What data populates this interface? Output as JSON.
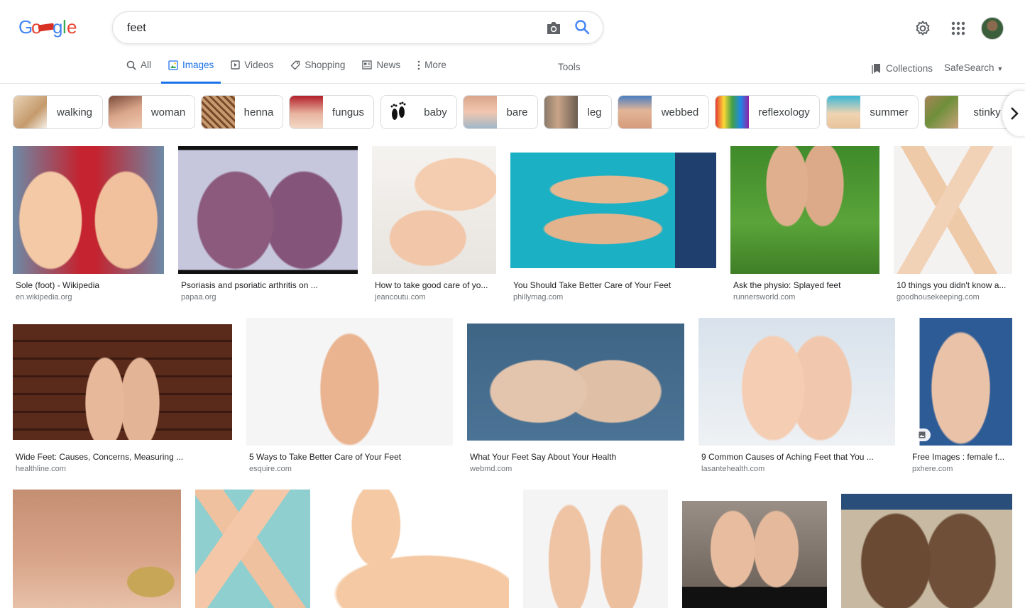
{
  "search": {
    "query": "feet"
  },
  "tabs": [
    {
      "label": "All",
      "icon": "search-icon"
    },
    {
      "label": "Images",
      "icon": "image-icon",
      "active": true
    },
    {
      "label": "Videos",
      "icon": "video-icon"
    },
    {
      "label": "Shopping",
      "icon": "tag-icon"
    },
    {
      "label": "News",
      "icon": "news-icon"
    },
    {
      "label": "More",
      "icon": "more-vert-icon"
    }
  ],
  "tools_label": "Tools",
  "collections_label": "Collections",
  "safesearch_label": "SafeSearch",
  "chips": [
    "walking",
    "woman",
    "henna",
    "fungus",
    "baby",
    "bare",
    "leg",
    "webbed",
    "reflexology",
    "summer",
    "stinky"
  ],
  "results": [
    {
      "title": "Sole (foot) - Wikipedia",
      "source": "en.wikipedia.org"
    },
    {
      "title": "Psoriasis and psoriatic arthritis on ...",
      "source": "papaa.org"
    },
    {
      "title": "How to take good care of yo...",
      "source": "jeancoutu.com"
    },
    {
      "title": "You Should Take Better Care of Your Feet",
      "source": "phillymag.com"
    },
    {
      "title": "Ask the physio: Splayed feet",
      "source": "runnersworld.com"
    },
    {
      "title": "10 things you didn't know a...",
      "source": "goodhousekeeping.com"
    },
    {
      "title": "Wide Feet: Causes, Concerns, Measuring ...",
      "source": "healthline.com"
    },
    {
      "title": "5 Ways to Take Better Care of Your Feet",
      "source": "esquire.com"
    },
    {
      "title": "What Your Feet Say About Your Health",
      "source": "webmd.com"
    },
    {
      "title": "9 Common Causes of Aching Feet that You ...",
      "source": "lasantehealth.com"
    },
    {
      "title": "Free Images : female f...",
      "source": "pxhere.com"
    }
  ],
  "colors": {
    "accent": "#1a73e8",
    "text_secondary": "#5f6368",
    "border": "#dadce0"
  }
}
